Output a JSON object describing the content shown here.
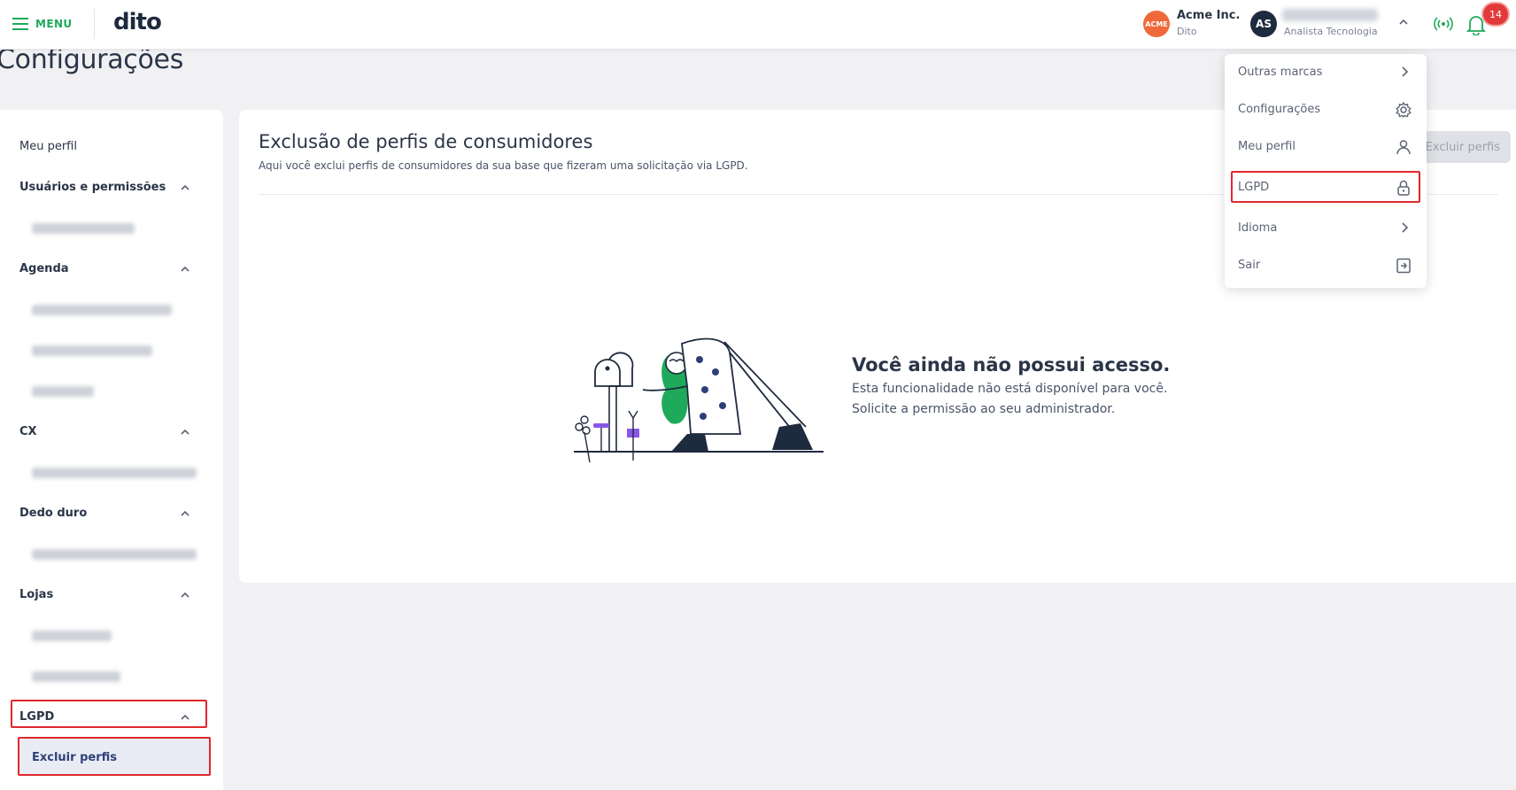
{
  "header": {
    "menu_label": "MENU",
    "logo_text": "dito",
    "company": {
      "badge": "ACME",
      "name": "Acme Inc.",
      "sub": "Dito"
    },
    "user": {
      "initials": "AS",
      "role": "Analista Tecnologia"
    },
    "notifications_count": "14"
  },
  "page": {
    "title": "Configurações"
  },
  "sidebar": {
    "meu_perfil": "Meu perfil",
    "sections": [
      {
        "label": "Usuários e permissões"
      },
      {
        "label": "Agenda"
      },
      {
        "label": "CX"
      },
      {
        "label": "Dedo duro"
      },
      {
        "label": "Lojas"
      },
      {
        "label": "LGPD"
      }
    ],
    "active_item": "Excluir perfis"
  },
  "main": {
    "title": "Exclusão de perfis de consumidores",
    "subtitle": "Aqui você exclui perfis de consumidores da sua base que fizeram uma solicitação via LGPD.",
    "action_button": "Excluir perfis",
    "empty_state": {
      "title": "Você ainda não possui acesso.",
      "line1": "Esta funcionalidade não está disponível para você.",
      "line2": "Solicite a permissão ao seu administrador."
    }
  },
  "dropdown": {
    "items": [
      {
        "label": "Outras marcas",
        "icon": "chevron-right-icon"
      },
      {
        "label": "Configurações",
        "icon": "gear-icon"
      },
      {
        "label": "Meu perfil",
        "icon": "user-icon"
      },
      {
        "label": "LGPD",
        "icon": "lock-icon"
      },
      {
        "label": "Idioma",
        "icon": "chevron-right-icon"
      },
      {
        "label": "Sair",
        "icon": "logout-icon"
      }
    ]
  },
  "colors": {
    "accent_green": "#1faa5b",
    "navy": "#1e2a3d",
    "alert_red": "#e0282e",
    "acme_orange": "#ef6a3a"
  }
}
